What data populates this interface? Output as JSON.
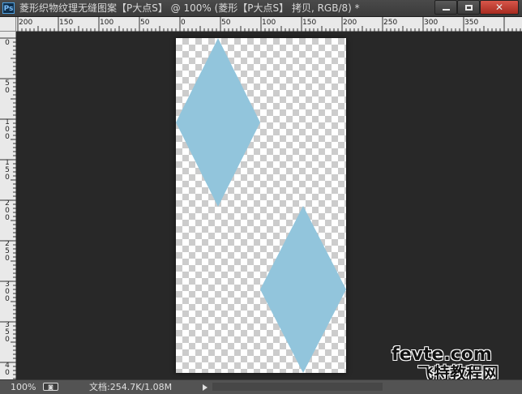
{
  "app": {
    "logo": "Ps",
    "document_title": "菱形织物纹理无缝图案【P大点S】 @ 100% (菱形【P大点S】  拷贝, RGB/8) *"
  },
  "window_controls": {
    "minimize_icon": "minimize-icon",
    "maximize_icon": "maximize-icon",
    "close_glyph": "✕"
  },
  "ruler_top": {
    "labels": [
      "200",
      "150",
      "100",
      "50",
      "0",
      "50",
      "100",
      "150",
      "200",
      "250",
      "300",
      "350"
    ]
  },
  "ruler_left": {
    "labels": [
      "0",
      "50",
      "100",
      "150",
      "200",
      "250",
      "300",
      "350",
      "40"
    ]
  },
  "canvas": {
    "background": "transparency-checkerboard",
    "shape_color": "#92c5dc",
    "shapes": [
      "diamond",
      "diamond"
    ]
  },
  "watermark": {
    "line1": "fevte.com",
    "line2": "飞特教程网"
  },
  "statusbar": {
    "zoom": "100%",
    "icon": "preview-icon",
    "doc_info": "文档:254.7K/1.08M",
    "arrow_icon": "right-arrow-icon"
  }
}
